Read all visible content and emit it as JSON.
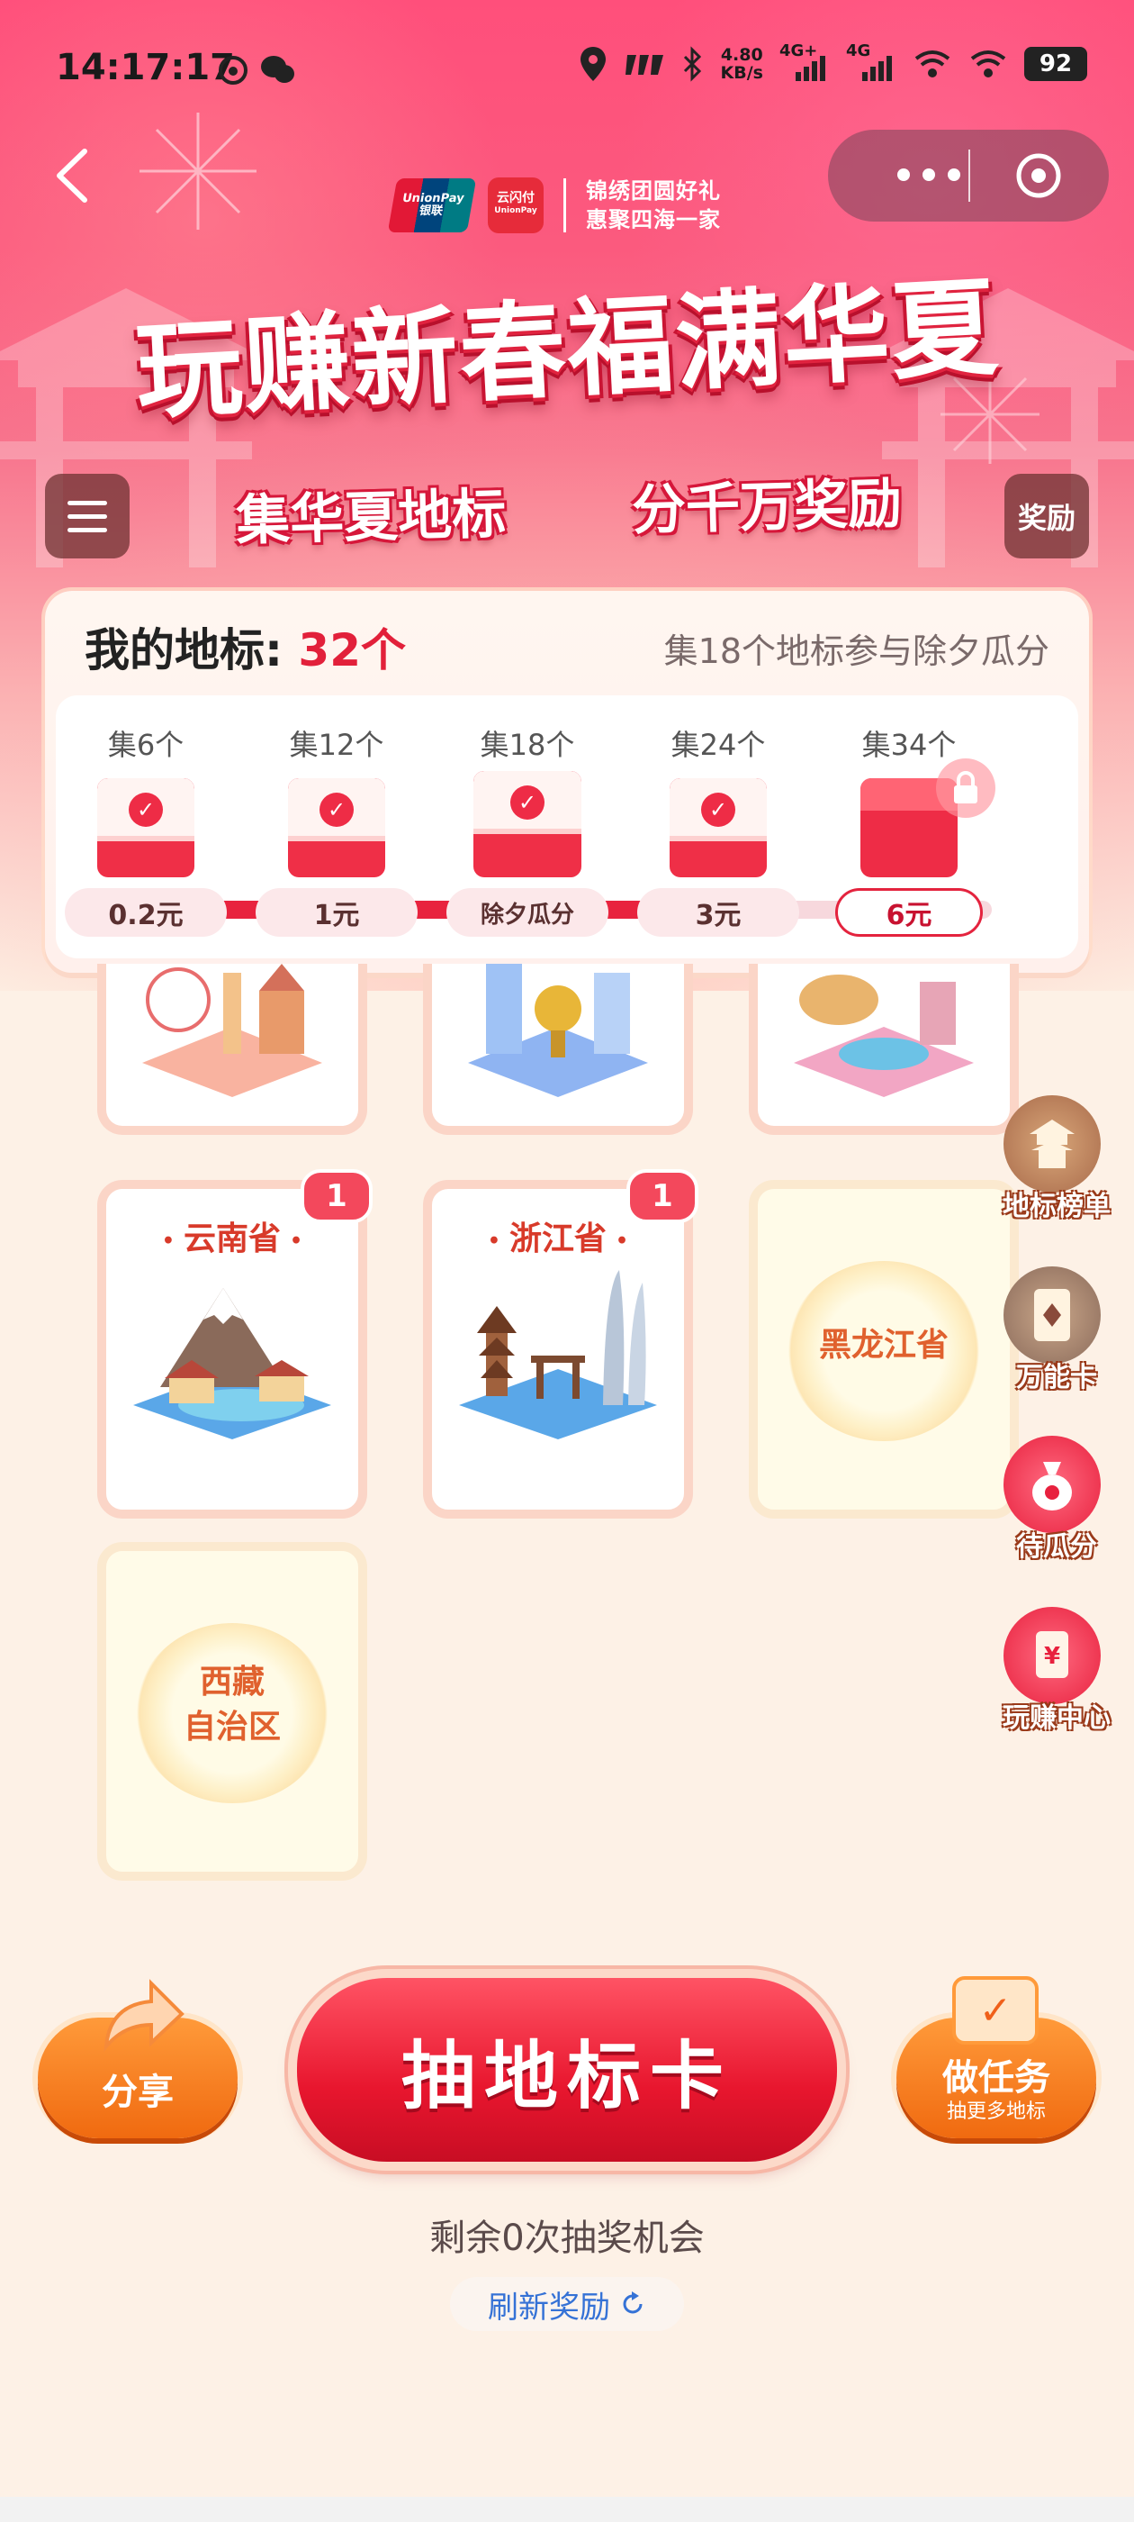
{
  "status_bar": {
    "time": "14:17:17",
    "net_speed_value": "4.80",
    "net_speed_unit": "KB/s",
    "signal1": "4G+",
    "signal2": "4G",
    "battery": "92"
  },
  "header": {
    "slogan_line1": "锦绣团圆好礼",
    "slogan_line2": "惠聚四海一家",
    "unionpay_text1": "UnionPay",
    "unionpay_text2": "银联",
    "yunshanfu_text1": "云闪付",
    "yunshanfu_text2": "UnionPay",
    "title": "玩赚新春福满华夏",
    "subtitle_left": "集华夏地标",
    "subtitle_right": "分千万奖励",
    "reward_button": "奖励"
  },
  "progress": {
    "title_prefix": "我的地标:",
    "count": "32个",
    "hint": "集18个地标参与除夕瓜分",
    "milestones": [
      {
        "label": "集6个",
        "amount": "0.2元",
        "done": true
      },
      {
        "label": "集12个",
        "amount": "1元",
        "done": true
      },
      {
        "label": "集18个",
        "amount": "除夕瓜分",
        "done": true
      },
      {
        "label": "集24个",
        "amount": "3元",
        "done": true
      },
      {
        "label": "集34个",
        "amount": "6元",
        "done": false
      }
    ]
  },
  "cards": [
    {
      "name": "云南省",
      "badge": "1"
    },
    {
      "name": "浙江省",
      "badge": "1"
    },
    {
      "name": "黑龙江省"
    },
    {
      "name_line1": "西藏",
      "name_line2": "自治区"
    }
  ],
  "side_buttons": [
    {
      "label": "地标榜单",
      "icon": "pagoda-icon"
    },
    {
      "label": "万能卡",
      "icon": "card-icon"
    },
    {
      "label": "待瓜分",
      "icon": "money-bag-icon"
    },
    {
      "label": "玩赚中心",
      "icon": "red-envelope-icon"
    }
  ],
  "actions": {
    "share": "分享",
    "draw": "抽地标卡",
    "task": "做任务",
    "task_sub": "抽更多地标",
    "remaining": "剩余0次抽奖机会",
    "refresh": "刷新奖励"
  },
  "colors": {
    "brand_red": "#e8233e",
    "accent_orange": "#f06a10",
    "link_blue": "#3572d6"
  }
}
